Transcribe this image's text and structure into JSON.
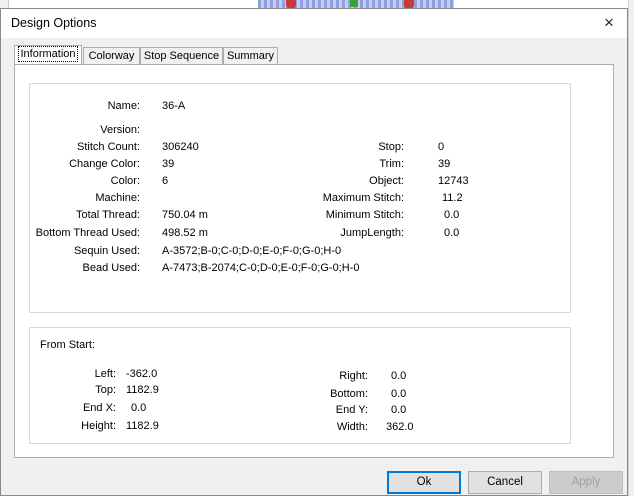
{
  "dialog": {
    "title": "Design Options",
    "close_icon": "×"
  },
  "tabs": [
    "Information",
    "Colorway",
    "Stop Sequence",
    "Summary"
  ],
  "info": {
    "name_label": "Name:",
    "name_value": "36-A",
    "version_label": "Version:",
    "version_value": "",
    "left_rows": [
      {
        "label": "Stitch Count:",
        "value": "306240"
      },
      {
        "label": "Change Color:",
        "value": "39"
      },
      {
        "label": "Color:",
        "value": "6"
      },
      {
        "label": "Machine:",
        "value": ""
      },
      {
        "label": "Total Thread:",
        "value": "750.04 m"
      },
      {
        "label": "Bottom Thread Used:",
        "value": "498.52 m"
      },
      {
        "label": "Sequin Used:",
        "value": "A-3572;B-0;C-0;D-0;E-0;F-0;G-0;H-0"
      },
      {
        "label": "Bead Used:",
        "value": "A-7473;B-2074;C-0;D-0;E-0;F-0;G-0;H-0"
      }
    ],
    "right_rows": [
      {
        "label": "Stop:",
        "value": "0"
      },
      {
        "label": "Trim:",
        "value": "39"
      },
      {
        "label": "Object:",
        "value": "12743"
      },
      {
        "label": "Maximum Stitch:",
        "value": "11.2"
      },
      {
        "label": "Minimum Stitch:",
        "value": "0.0"
      },
      {
        "label": "JumpLength:",
        "value": "0.0"
      }
    ]
  },
  "from_start": {
    "heading": "From Start:",
    "left_rows": [
      {
        "label": "Left:",
        "value": "-362.0"
      },
      {
        "label": "Top:",
        "value": "1182.9"
      },
      {
        "label": "End X:",
        "value": "0.0"
      },
      {
        "label": "Height:",
        "value": "1182.9"
      }
    ],
    "right_rows": [
      {
        "label": "Right:",
        "value": "0.0"
      },
      {
        "label": "Bottom:",
        "value": "0.0"
      },
      {
        "label": "End Y:",
        "value": "0.0"
      },
      {
        "label": "Width:",
        "value": "362.0"
      }
    ]
  },
  "buttons": {
    "ok": "Ok",
    "cancel": "Cancel",
    "apply": "Apply"
  },
  "colors": {
    "dialog_bg": "#f0f0f0",
    "default_button_border": "#0078d7"
  }
}
